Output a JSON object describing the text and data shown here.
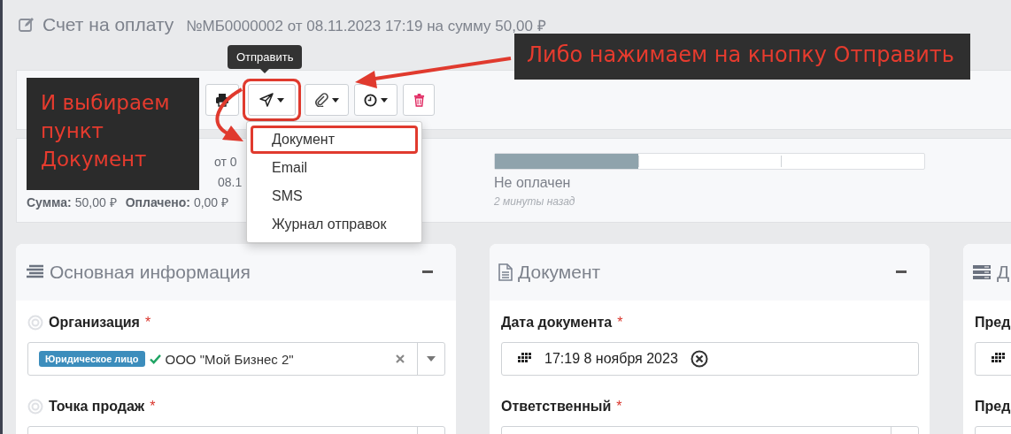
{
  "page_title": {
    "title": "Счет на оплату",
    "subtitle": "№МБ0000002 от 08.11.2023 17:19 на сумму 50,00 ₽"
  },
  "toolbar": [
    {
      "kind": "print"
    },
    {
      "kind": "send",
      "caret": true,
      "annotated": true
    },
    {
      "kind": "attach",
      "caret": true
    },
    {
      "kind": "clock",
      "caret": true
    },
    {
      "kind": "delete"
    }
  ],
  "tooltip": "Отправить",
  "send_menu": [
    {
      "label": "Документ",
      "annotated": true
    },
    {
      "label": "Email"
    },
    {
      "label": "SMS"
    },
    {
      "label": "Журнал отправок"
    }
  ],
  "summary": {
    "reference_tail": "от 0",
    "created_tail": "08.1",
    "totals": [
      {
        "label": "Сумма:",
        "value": "50,00 ₽"
      },
      {
        "label": "Оплачено:",
        "value": "0,00 ₽"
      }
    ],
    "progress": {
      "level": 0.335,
      "status": "Не оплачен",
      "time": "2 минуты назад"
    }
  },
  "cards": [
    {
      "title": "Основная информация",
      "collapsible": true,
      "fields": [
        {
          "label": "Организация",
          "mark": "*",
          "help": true,
          "kind": "select",
          "badge": "Юридическое лицо",
          "verified": true,
          "value": "ООО \"Мой Бизнес 2\"",
          "clearable": true
        },
        {
          "label": "Точка продаж",
          "mark": "*",
          "help": true,
          "kind": "select"
        }
      ]
    },
    {
      "title": "Документ",
      "collapsible": true,
      "fields": [
        {
          "label": "Дата документа",
          "mark": "*",
          "kind": "date",
          "value": "17:19 8 ноября 2023",
          "clearable": true
        },
        {
          "label": "Ответственный",
          "mark": "*",
          "kind": "user-select"
        }
      ]
    },
    {
      "title": "Д",
      "fields": [
        {
          "label": "Пред",
          "kind": "date"
        },
        {
          "label": "Пред",
          "kind": "date"
        }
      ]
    }
  ],
  "annotations": [
    {
      "kind": "callout-right",
      "text": "Либо нажимаем на кнопку Отправить"
    },
    {
      "kind": "callout-left",
      "lines": [
        "И выбираем",
        "пункт",
        "Документ"
      ]
    }
  ]
}
